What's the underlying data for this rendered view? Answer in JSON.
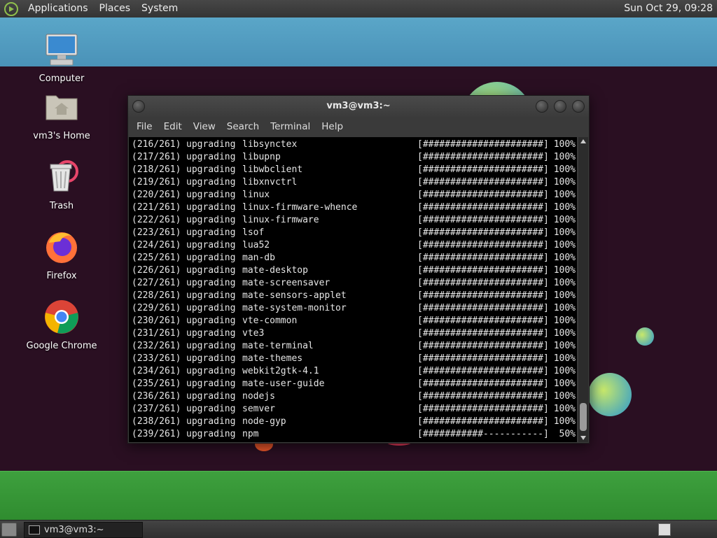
{
  "top_panel": {
    "menus": [
      "Applications",
      "Places",
      "System"
    ],
    "clock": "Sun Oct 29, 09:28"
  },
  "desktop_icons": [
    {
      "label": "Computer",
      "icon": "computer-icon"
    },
    {
      "label": "vm3's Home",
      "icon": "home-folder-icon"
    },
    {
      "label": "Trash",
      "icon": "trash-icon"
    },
    {
      "label": "Firefox",
      "icon": "firefox-icon"
    },
    {
      "label": "Google Chrome",
      "icon": "chrome-icon"
    }
  ],
  "terminal": {
    "title": "vm3@vm3:~",
    "menu": [
      "File",
      "Edit",
      "View",
      "Search",
      "Terminal",
      "Help"
    ],
    "lines": [
      {
        "num": "(216/261)",
        "verb": "upgrading",
        "pkg": "libsynctex",
        "bar": "[######################]",
        "pct": "100%"
      },
      {
        "num": "(217/261)",
        "verb": "upgrading",
        "pkg": "libupnp",
        "bar": "[######################]",
        "pct": "100%"
      },
      {
        "num": "(218/261)",
        "verb": "upgrading",
        "pkg": "libwbclient",
        "bar": "[######################]",
        "pct": "100%"
      },
      {
        "num": "(219/261)",
        "verb": "upgrading",
        "pkg": "libxnvctrl",
        "bar": "[######################]",
        "pct": "100%"
      },
      {
        "num": "(220/261)",
        "verb": "upgrading",
        "pkg": "linux",
        "bar": "[######################]",
        "pct": "100%"
      },
      {
        "num": "(221/261)",
        "verb": "upgrading",
        "pkg": "linux-firmware-whence",
        "bar": "[######################]",
        "pct": "100%"
      },
      {
        "num": "(222/261)",
        "verb": "upgrading",
        "pkg": "linux-firmware",
        "bar": "[######################]",
        "pct": "100%"
      },
      {
        "num": "(223/261)",
        "verb": "upgrading",
        "pkg": "lsof",
        "bar": "[######################]",
        "pct": "100%"
      },
      {
        "num": "(224/261)",
        "verb": "upgrading",
        "pkg": "lua52",
        "bar": "[######################]",
        "pct": "100%"
      },
      {
        "num": "(225/261)",
        "verb": "upgrading",
        "pkg": "man-db",
        "bar": "[######################]",
        "pct": "100%"
      },
      {
        "num": "(226/261)",
        "verb": "upgrading",
        "pkg": "mate-desktop",
        "bar": "[######################]",
        "pct": "100%"
      },
      {
        "num": "(227/261)",
        "verb": "upgrading",
        "pkg": "mate-screensaver",
        "bar": "[######################]",
        "pct": "100%"
      },
      {
        "num": "(228/261)",
        "verb": "upgrading",
        "pkg": "mate-sensors-applet",
        "bar": "[######################]",
        "pct": "100%"
      },
      {
        "num": "(229/261)",
        "verb": "upgrading",
        "pkg": "mate-system-monitor",
        "bar": "[######################]",
        "pct": "100%"
      },
      {
        "num": "(230/261)",
        "verb": "upgrading",
        "pkg": "vte-common",
        "bar": "[######################]",
        "pct": "100%"
      },
      {
        "num": "(231/261)",
        "verb": "upgrading",
        "pkg": "vte3",
        "bar": "[######################]",
        "pct": "100%"
      },
      {
        "num": "(232/261)",
        "verb": "upgrading",
        "pkg": "mate-terminal",
        "bar": "[######################]",
        "pct": "100%"
      },
      {
        "num": "(233/261)",
        "verb": "upgrading",
        "pkg": "mate-themes",
        "bar": "[######################]",
        "pct": "100%"
      },
      {
        "num": "(234/261)",
        "verb": "upgrading",
        "pkg": "webkit2gtk-4.1",
        "bar": "[######################]",
        "pct": "100%"
      },
      {
        "num": "(235/261)",
        "verb": "upgrading",
        "pkg": "mate-user-guide",
        "bar": "[######################]",
        "pct": "100%"
      },
      {
        "num": "(236/261)",
        "verb": "upgrading",
        "pkg": "nodejs",
        "bar": "[######################]",
        "pct": "100%"
      },
      {
        "num": "(237/261)",
        "verb": "upgrading",
        "pkg": "semver",
        "bar": "[######################]",
        "pct": "100%"
      },
      {
        "num": "(238/261)",
        "verb": "upgrading",
        "pkg": "node-gyp",
        "bar": "[######################]",
        "pct": "100%"
      },
      {
        "num": "(239/261)",
        "verb": "upgrading",
        "pkg": "npm",
        "bar": "[###########-----------]",
        "pct": "50%"
      }
    ]
  },
  "taskbar": {
    "window_label": "vm3@vm3:~"
  }
}
